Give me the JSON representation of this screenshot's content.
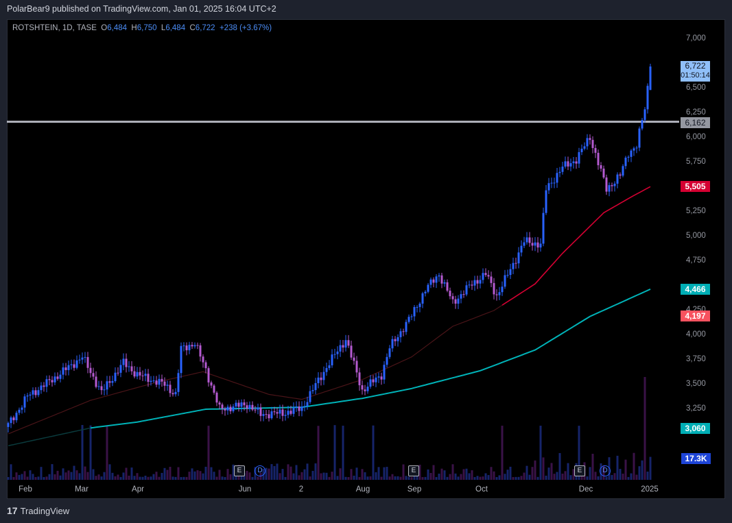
{
  "header": {
    "published": "PolarBear9 published on TradingView.com, Jan 01, 2025 16:04 UTC+2"
  },
  "legend": {
    "symbol": "ROTSHTEIN, 1D, TASE",
    "o_label": "O",
    "o": "6,484",
    "h_label": "H",
    "h": "6,750",
    "l_label": "L",
    "l": "6,484",
    "c_label": "C",
    "c": "6,722",
    "change": "+238 (+3.67%)"
  },
  "price_axis": {
    "ticks": [
      "7,000",
      "6,500",
      "6,250",
      "6,000",
      "5,750",
      "5,250",
      "5,000",
      "4,750",
      "4,250",
      "4,000",
      "3,750",
      "3,500",
      "3,250"
    ]
  },
  "tags": {
    "last_price": "6,722",
    "countdown": "01:50:14",
    "hline": "6,162",
    "ma_red": "5,505",
    "ma_teal": "4,466",
    "ma_dark": "4,197",
    "ma_teal_start": "3,060",
    "volume": "17.3K"
  },
  "time_axis": {
    "labels": [
      "Feb",
      "Mar",
      "Apr",
      "Jun",
      "2",
      "Aug",
      "Sep",
      "Oct",
      "Dec",
      "2025"
    ]
  },
  "events": [
    "E",
    "D",
    "E",
    "E",
    "D"
  ],
  "footer": {
    "brand": "TradingView"
  },
  "colors": {
    "up": "#2962ff",
    "down": "#b45ad0",
    "ma_red": "#d50032",
    "ma_teal": "#00b3b8",
    "hline": "#b2b5be"
  },
  "chart_data": {
    "type": "candlestick",
    "y_range": [
      3000,
      7000
    ],
    "hline": 6162,
    "close_keypoints": [
      [
        0,
        3090
      ],
      [
        7,
        3380
      ],
      [
        17,
        3570
      ],
      [
        27,
        3780
      ],
      [
        34,
        3420
      ],
      [
        42,
        3720
      ],
      [
        47,
        3600
      ],
      [
        57,
        3500
      ],
      [
        61,
        3400
      ],
      [
        63,
        3860
      ],
      [
        68,
        3920
      ],
      [
        72,
        3650
      ],
      [
        77,
        3250
      ],
      [
        87,
        3300
      ],
      [
        92,
        3200
      ],
      [
        100,
        3210
      ],
      [
        107,
        3260
      ],
      [
        111,
        3450
      ],
      [
        117,
        3720
      ],
      [
        123,
        3960
      ],
      [
        129,
        3440
      ],
      [
        136,
        3600
      ],
      [
        139,
        3870
      ],
      [
        147,
        4200
      ],
      [
        152,
        4460
      ],
      [
        157,
        4620
      ],
      [
        162,
        4330
      ],
      [
        169,
        4520
      ],
      [
        174,
        4620
      ],
      [
        178,
        4400
      ],
      [
        184,
        4720
      ],
      [
        188,
        4950
      ],
      [
        194,
        4920
      ],
      [
        196,
        5480
      ],
      [
        202,
        5700
      ],
      [
        207,
        5780
      ],
      [
        212,
        6010
      ],
      [
        218,
        5480
      ],
      [
        223,
        5620
      ],
      [
        226,
        5850
      ],
      [
        229,
        5920
      ],
      [
        232,
        6300
      ],
      [
        234,
        6722
      ]
    ],
    "ma_red": [
      [
        0,
        3000
      ],
      [
        30,
        3340
      ],
      [
        55,
        3530
      ],
      [
        71,
        3630
      ],
      [
        95,
        3400
      ],
      [
        107,
        3350
      ],
      [
        129,
        3550
      ],
      [
        147,
        3780
      ],
      [
        162,
        4090
      ],
      [
        177,
        4250
      ],
      [
        192,
        4520
      ],
      [
        202,
        4830
      ],
      [
        217,
        5240
      ],
      [
        227,
        5400
      ],
      [
        234,
        5505
      ]
    ],
    "ma_teal": [
      [
        0,
        2880
      ],
      [
        30,
        3060
      ],
      [
        47,
        3120
      ],
      [
        72,
        3250
      ],
      [
        107,
        3270
      ],
      [
        129,
        3360
      ],
      [
        147,
        3460
      ],
      [
        172,
        3640
      ],
      [
        192,
        3850
      ],
      [
        212,
        4190
      ],
      [
        234,
        4466
      ]
    ]
  }
}
